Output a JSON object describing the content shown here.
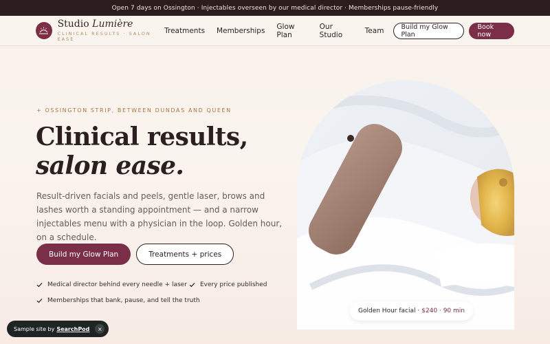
{
  "announcement": "Open 7 days on Ossington · Injectables overseen by our medical director · Memberships pause-friendly",
  "brand": {
    "name": "Studio",
    "name_italic": "Lumière",
    "tagline": "CLINICAL RESULTS · SALON EASE"
  },
  "nav": {
    "links": [
      "Treatments",
      "Memberships",
      "Glow Plan",
      "Our Studio",
      "Team"
    ],
    "outline_button": "Build my Glow Plan",
    "solid_button": "Book now"
  },
  "hero": {
    "eyebrow": "+ OSSINGTON STRIP, BETWEEN DUNDAS AND QUEEN",
    "title_line1": "Clinical results,",
    "title_line2": "salon ease.",
    "lede": "Result-driven facials and peels, gentle laser, brows and lashes worth a standing appointment — and a narrow injectables menu with a physician in the loop. Golden hour, on a schedule.",
    "cta_primary": "Build my Glow Plan",
    "cta_secondary": "Treatments + prices",
    "checks": [
      "Medical director behind every needle + laser",
      "Every price published",
      "Memberships that bank, pause, and tell the truth"
    ],
    "badge": {
      "label": "Golden Hour facial ·",
      "price": "$240 · 90 min"
    }
  },
  "footer_pill": {
    "prefix": "Sample site by",
    "brand": "SearchPod",
    "close": "×"
  },
  "colors": {
    "accent": "#7a2e48",
    "dark": "#2b1d1e",
    "gold": "#a4763f"
  }
}
